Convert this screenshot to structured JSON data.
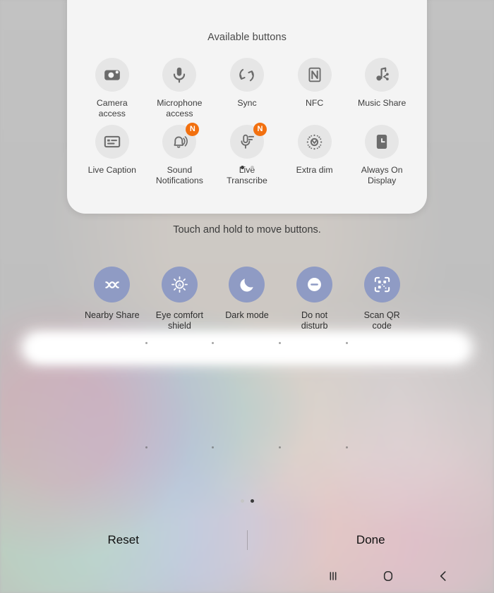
{
  "sheet": {
    "title": "Available buttons",
    "available_buttons": [
      {
        "label": "Camera\naccess",
        "icon": "camera-icon",
        "badge": null
      },
      {
        "label": "Microphone\naccess",
        "icon": "microphone-icon",
        "badge": null
      },
      {
        "label": "Sync",
        "icon": "sync-icon",
        "badge": null
      },
      {
        "label": "NFC",
        "icon": "nfc-icon",
        "badge": null
      },
      {
        "label": "Music Share",
        "icon": "music-share-icon",
        "badge": null
      },
      {
        "label": "Live Caption",
        "icon": "live-caption-icon",
        "badge": null
      },
      {
        "label": "Sound\nNotifications",
        "icon": "sound-notifications-icon",
        "badge": "N"
      },
      {
        "label": "Live\nTranscribe",
        "icon": "live-transcribe-icon",
        "badge": "N"
      },
      {
        "label": "Extra dim",
        "icon": "extra-dim-icon",
        "badge": null
      },
      {
        "label": "Always On\nDisplay",
        "icon": "always-on-display-icon",
        "badge": null
      }
    ],
    "page_dots": {
      "count": 2,
      "active_index": 0
    }
  },
  "hint": "Touch and hold to move buttons.",
  "active_buttons": [
    {
      "label": "Nearby Share",
      "icon": "nearby-share-icon"
    },
    {
      "label": "Eye comfort\nshield",
      "icon": "eye-comfort-shield-icon"
    },
    {
      "label": "Dark mode",
      "icon": "dark-mode-icon"
    },
    {
      "label": "Do not\ndisturb",
      "icon": "do-not-disturb-icon"
    },
    {
      "label": "Scan QR\ncode",
      "icon": "scan-qr-code-icon"
    }
  ],
  "panel_dots": {
    "count": 2,
    "active_index": 1
  },
  "actions": {
    "reset_label": "Reset",
    "done_label": "Done"
  },
  "navbar": {
    "recents_label": "recents-icon",
    "home_label": "home-icon",
    "back_label": "back-icon"
  },
  "colors": {
    "active_tile": "#8f9bc4",
    "badge": "#f2700f",
    "sheet_bg": "#f4f4f4",
    "inactive_tile": "#e6e6e6",
    "background": "#bdbdbd"
  }
}
